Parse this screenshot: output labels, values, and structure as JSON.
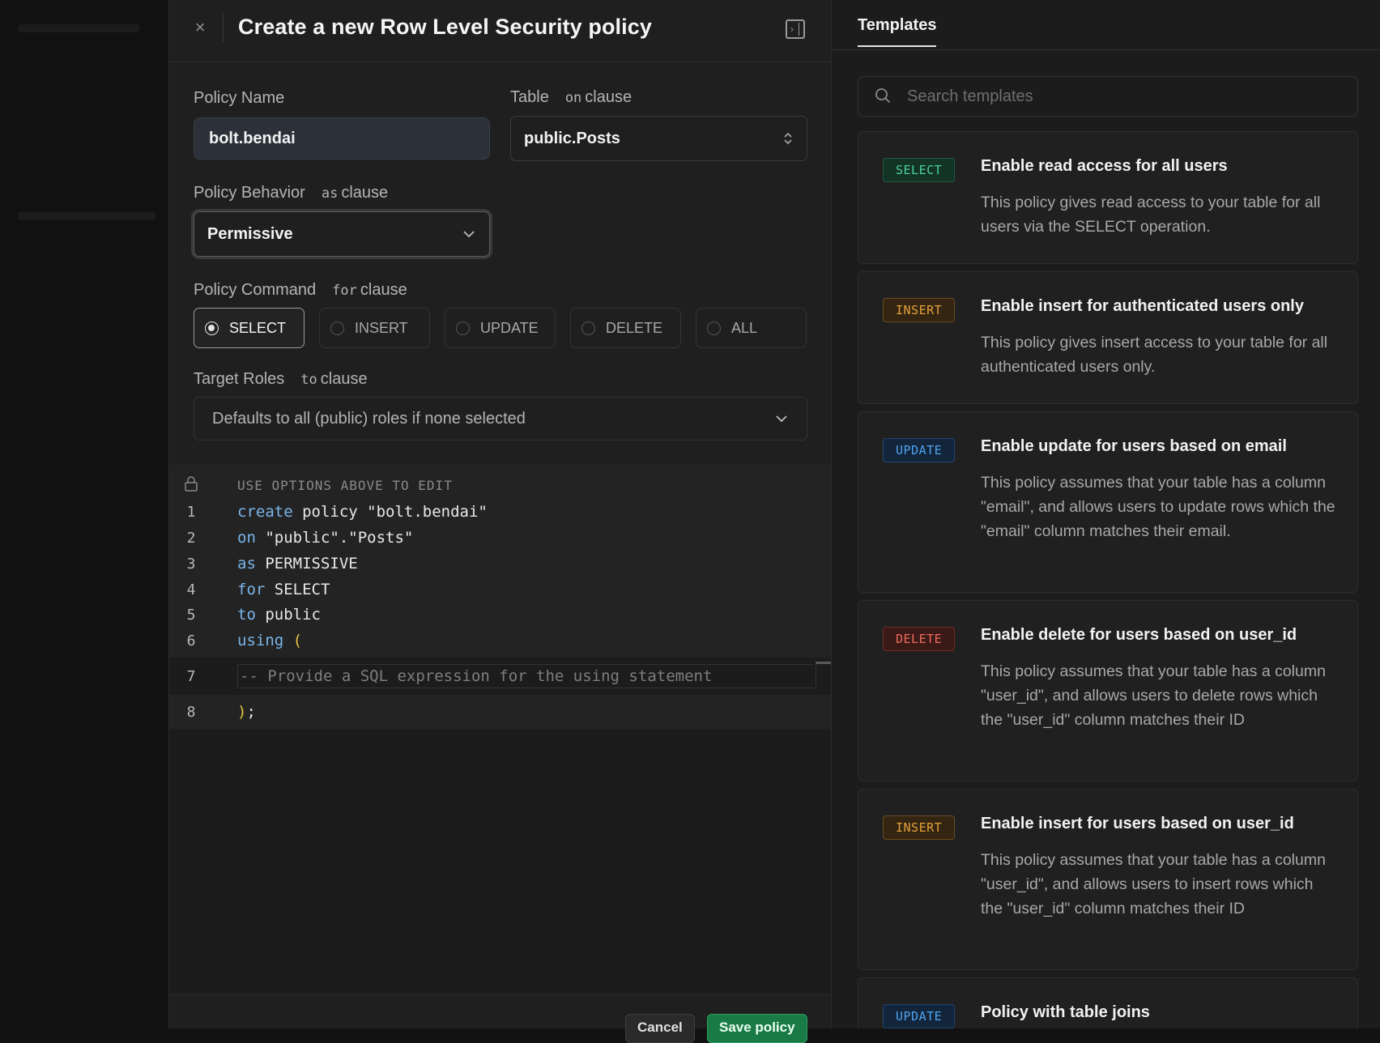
{
  "panel": {
    "title": "Create a new Row Level Security policy",
    "close_symbol": "×",
    "collapse_symbol": "›"
  },
  "form": {
    "policy_name": {
      "label": "Policy Name",
      "value": "bolt.bendai"
    },
    "table": {
      "label": "Table",
      "keyword": "on",
      "clause": "clause",
      "value": "public.Posts"
    },
    "behavior": {
      "label": "Policy Behavior",
      "keyword": "as",
      "clause": "clause",
      "value": "Permissive"
    },
    "command": {
      "label": "Policy Command",
      "keyword": "for",
      "clause": "clause",
      "options": [
        "SELECT",
        "INSERT",
        "UPDATE",
        "DELETE",
        "ALL"
      ],
      "selected": "SELECT"
    },
    "roles": {
      "label": "Target Roles",
      "keyword": "to",
      "clause": "clause",
      "placeholder": "Defaults to all (public) roles if none selected"
    }
  },
  "editor": {
    "readonly_note": "USE OPTIONS ABOVE TO EDIT",
    "lines": [
      {
        "n": "1",
        "kw": "create",
        "rest": " policy \"bolt.bendai\""
      },
      {
        "n": "2",
        "kw": "on",
        "rest": " \"public\".\"Posts\""
      },
      {
        "n": "3",
        "kw": "as",
        "rest": " PERMISSIVE"
      },
      {
        "n": "4",
        "kw": "for",
        "rest": " SELECT"
      },
      {
        "n": "5",
        "kw": "to",
        "rest": " public"
      },
      {
        "n": "6",
        "kw": "using",
        "rest": " ("
      }
    ],
    "line7": {
      "n": "7",
      "comment": "-- Provide a SQL expression for the using statement"
    },
    "line8": {
      "n": "8",
      "paren": ")",
      "rest": ";"
    }
  },
  "footer": {
    "cancel": "Cancel",
    "save": "Save policy"
  },
  "templates": {
    "tab": "Templates",
    "search_placeholder": "Search templates",
    "items": [
      {
        "badge": "SELECT",
        "title": "Enable read access for all users",
        "desc": "This policy gives read access to your table for all users via the SELECT operation."
      },
      {
        "badge": "INSERT",
        "title": "Enable insert for authenticated users only",
        "desc": "This policy gives insert access to your table for all authenticated users only."
      },
      {
        "badge": "UPDATE",
        "title": "Enable update for users based on email",
        "desc": "This policy assumes that your table has a column \"email\", and allows users to update rows which the \"email\" column matches their email."
      },
      {
        "badge": "DELETE",
        "title": "Enable delete for users based on user_id",
        "desc": "This policy assumes that your table has a column \"user_id\", and allows users to delete rows which the \"user_id\" column matches their ID"
      },
      {
        "badge": "INSERT",
        "title": "Enable insert for users based on user_id",
        "desc": "This policy assumes that your table has a column \"user_id\", and allows users to insert rows which the \"user_id\" column matches their ID"
      },
      {
        "badge": "UPDATE",
        "title": "Policy with table joins",
        "desc": ""
      }
    ]
  },
  "colors": {
    "select": "#4fd19a",
    "insert": "#e6a13a",
    "update": "#4fa2ee",
    "delete": "#ef6a5c",
    "save": "#1a7a46"
  }
}
